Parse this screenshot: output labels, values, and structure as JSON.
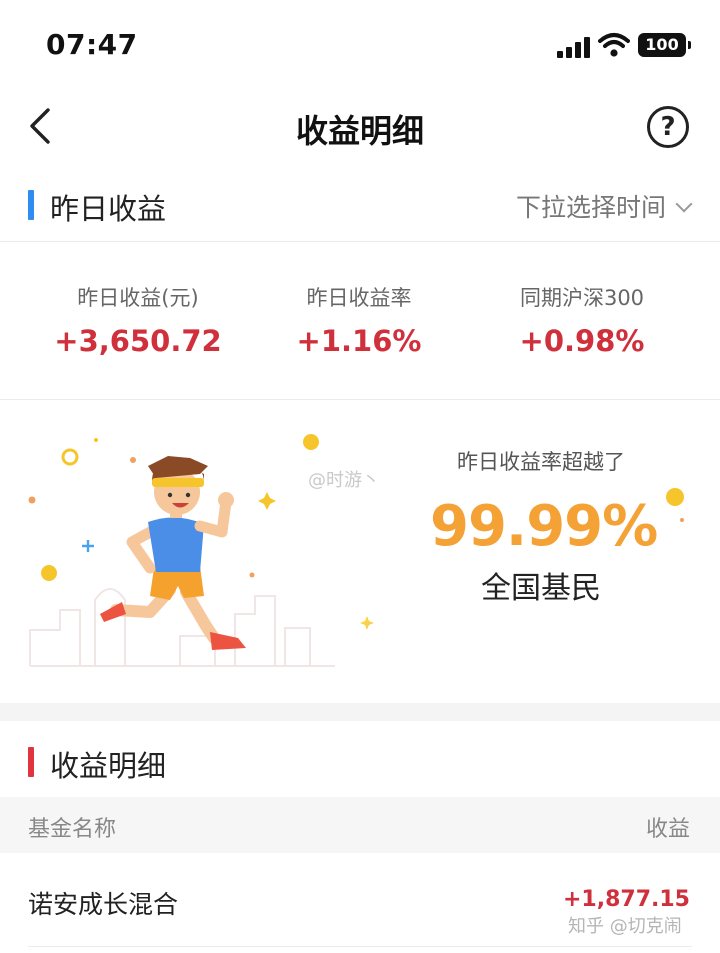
{
  "status_bar": {
    "time": "07:47",
    "battery": "100"
  },
  "nav": {
    "title": "收益明细"
  },
  "yesterday_section": {
    "title": "昨日收益",
    "time_picker": "下拉选择时间"
  },
  "stats": [
    {
      "label": "昨日收益(元)",
      "value": "+3,650.72"
    },
    {
      "label": "昨日收益率",
      "value": "+1.16%"
    },
    {
      "label": "同期沪深300",
      "value": "+0.98%"
    }
  ],
  "banner": {
    "label": "昨日收益率超越了",
    "percent": "99.99%",
    "subject": "全国基民",
    "watermark": "@时游丶"
  },
  "detail_section": {
    "title": "收益明细"
  },
  "table": {
    "headers": [
      "基金名称",
      "收益"
    ],
    "rows": [
      {
        "name": "诺安成长混合",
        "value": "+1,877.15"
      }
    ]
  },
  "watermark_zhihu": "知乎 @切克闹",
  "colors": {
    "accent_blue": "#2f8cf0",
    "accent_red": "#e0343e",
    "gain_red": "#d0303c",
    "highlight_orange": "#f4a235"
  }
}
